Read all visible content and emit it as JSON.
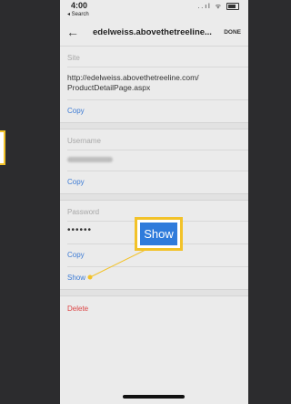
{
  "status_bar": {
    "time": "4:00",
    "back_app": "◂ Search",
    "icons": "..ıl ᯤ"
  },
  "app_bar": {
    "back": "←",
    "title": "edelweiss.abovethetreeline...",
    "done": "DONE"
  },
  "site": {
    "label": "Site",
    "value_line1": "http://edelweiss.abovethetreeline.com/",
    "value_line2": "ProductDetailPage.aspx",
    "copy": "Copy"
  },
  "username": {
    "label": "Username",
    "copy": "Copy"
  },
  "password": {
    "label": "Password",
    "value": "••••••",
    "copy": "Copy",
    "show": "Show"
  },
  "delete": "Delete",
  "callout": {
    "text": "Show"
  },
  "colors": {
    "accent": "#3d7bd4",
    "danger": "#dd4444",
    "callout_border": "#f2c229",
    "callout_fill": "#2f7bdb"
  }
}
